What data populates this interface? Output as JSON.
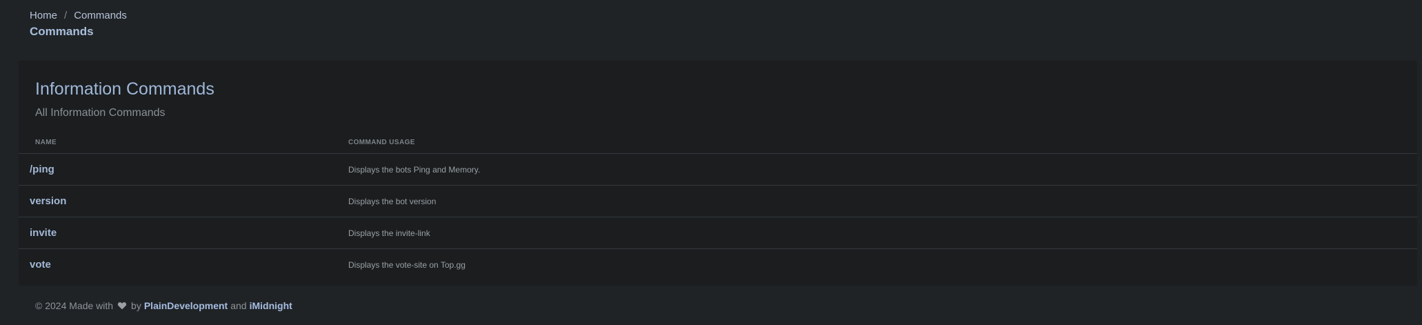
{
  "breadcrumb": {
    "home": "Home",
    "separator": "/",
    "current": "Commands"
  },
  "page_title": "Commands",
  "card": {
    "title": "Information Commands",
    "subtitle": "All Information Commands",
    "columns": {
      "name": "NAME",
      "usage": "COMMAND USAGE"
    },
    "rows": [
      {
        "name": "/ping",
        "usage": "Displays the bots Ping and Memory."
      },
      {
        "name": "version",
        "usage": "Displays the bot version"
      },
      {
        "name": "invite",
        "usage": "Displays the invite-link"
      },
      {
        "name": "vote",
        "usage": "Displays the vote-site on Top.gg"
      }
    ]
  },
  "footer": {
    "prefix": "© 2024 Made with",
    "icon": "heart-icon",
    "by": "by",
    "author1": "PlainDevelopment",
    "and": "and",
    "author2": "iMidnight"
  },
  "colors": {
    "background": "#1f2326",
    "card": "#1b1d1f",
    "accent": "#a3b8d6"
  }
}
